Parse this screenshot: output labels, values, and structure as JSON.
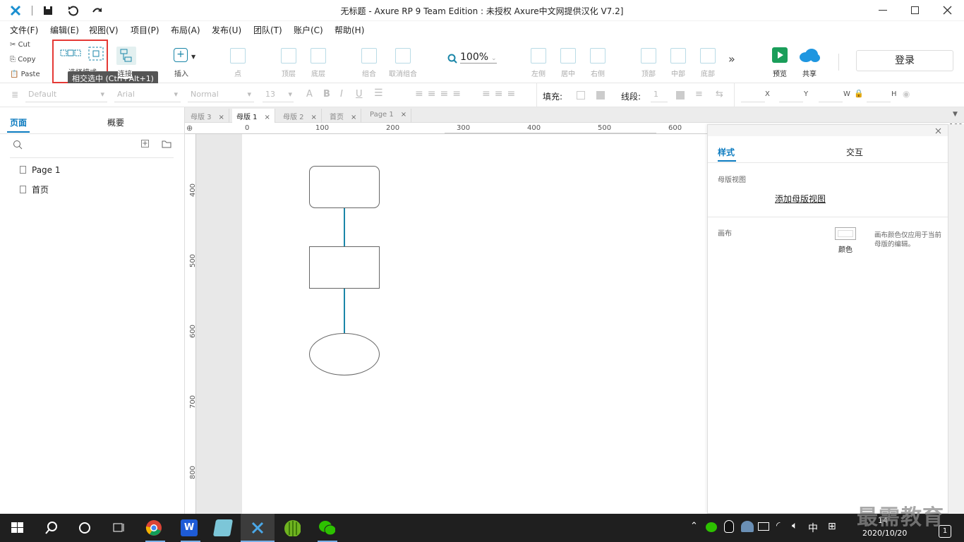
{
  "window": {
    "title": "无标题 - Axure RP 9 Team Edition : 未授权     Axure中文网提供汉化 V7.2]"
  },
  "menu": [
    "文件(F)",
    "编辑(E)",
    "视图(V)",
    "项目(P)",
    "布局(A)",
    "发布(U)",
    "团队(T)",
    "账户(C)",
    "帮助(H)"
  ],
  "clipboard": {
    "cut": "Cut",
    "copy": "Copy",
    "paste": "Paste"
  },
  "toolbar": {
    "select_mode_label": "选择模式",
    "tooltip": "相交选中 (Ctrl+Alt+1)",
    "connect_label": "连接",
    "insert_label": "插入",
    "point_label": "点",
    "top_label": "顶层",
    "bottom_label": "底层",
    "group_label": "组合",
    "ungroup_label": "取消组合",
    "zoom_value": "100%",
    "align_left": "左侧",
    "align_center": "居中",
    "align_right": "右侧",
    "align_top": "顶部",
    "align_middle": "中部",
    "align_bottom": "底部",
    "preview_label": "预览",
    "share_label": "共享",
    "login_label": "登录",
    "accent_color": "#1a9e5a",
    "share_color": "#1e96e0"
  },
  "format": {
    "style": "Default",
    "font": "Arial",
    "weight": "Normal",
    "size": "13",
    "fill_label": "填充:",
    "stroke_label": "线段:",
    "stroke_value": "1",
    "x_label": "X",
    "y_label": "Y",
    "w_label": "W",
    "h_label": "H"
  },
  "left_panel": {
    "tab_pages": "页面",
    "tab_outline": "概要",
    "pages": [
      "Page 1",
      "首页"
    ]
  },
  "doc_tabs": [
    {
      "label": "母版 3",
      "active": false
    },
    {
      "label": "母版 1",
      "active": true
    },
    {
      "label": "母版 2",
      "active": false
    },
    {
      "label": "首页",
      "active": false
    },
    {
      "label": "Page 1",
      "active": false
    }
  ],
  "ruler": {
    "top_ticks": [
      "0",
      "100",
      "200",
      "300",
      "400",
      "500",
      "600",
      "100"
    ],
    "left_ticks": [
      "400",
      "500",
      "600",
      "700",
      "800"
    ]
  },
  "right_panel": {
    "tab_style": "样式",
    "tab_interact": "交互",
    "master_view_heading": "母版视图",
    "add_master_view": "添加母版视图",
    "canvas_heading": "画布",
    "color_label": "颜色",
    "canvas_note": "画布颜色仅应用于当前母版的编辑。"
  },
  "taskbar": {
    "ime": "中",
    "time_partial": "14",
    "date": "2020/10/20",
    "notification_count": "1",
    "watermark": "最需教育"
  },
  "colors": {
    "connector": "#1a86a8",
    "accent": "#0a7abf",
    "highlight_box": "#e53935"
  }
}
